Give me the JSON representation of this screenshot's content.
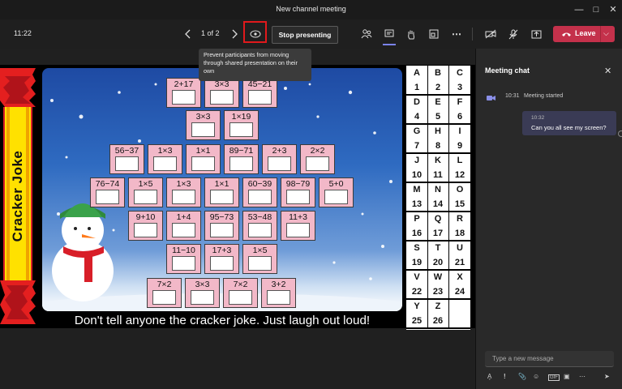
{
  "window": {
    "title": "New channel meeting"
  },
  "toolbar": {
    "time": "11:22",
    "page_count": "1 of 2",
    "stop_label": "Stop presenting",
    "leave_label": "Leave"
  },
  "tooltip": {
    "text": "Prevent participants from moving through shared presentation on their own"
  },
  "slide": {
    "cracker_title": "Cracker Joke",
    "caption": "Don't tell anyone the cracker joke. Just laugh out loud!",
    "rows": [
      [
        "2+17",
        "3×3",
        "45−21"
      ],
      [
        "3×3",
        "1×19"
      ],
      [
        "56−37",
        "1×3",
        "1×1",
        "89−71",
        "2+3",
        "2×2"
      ],
      [
        "76−74",
        "1×5",
        "1×3",
        "1×1",
        "60−39",
        "98−79",
        "5+0"
      ],
      [
        "9+10",
        "1+4",
        "95−73",
        "53−48",
        "11+3"
      ],
      [
        "11−10",
        "17+3",
        "1×5"
      ],
      [
        "7×2",
        "3×3",
        "7×2",
        "3+2"
      ]
    ],
    "key": [
      [
        "A",
        "B",
        "C"
      ],
      [
        "1",
        "2",
        "3"
      ],
      [
        "D",
        "E",
        "F"
      ],
      [
        "4",
        "5",
        "6"
      ],
      [
        "G",
        "H",
        "I"
      ],
      [
        "7",
        "8",
        "9"
      ],
      [
        "J",
        "K",
        "L"
      ],
      [
        "10",
        "11",
        "12"
      ],
      [
        "M",
        "N",
        "O"
      ],
      [
        "13",
        "14",
        "15"
      ],
      [
        "P",
        "Q",
        "R"
      ],
      [
        "16",
        "17",
        "18"
      ],
      [
        "S",
        "T",
        "U"
      ],
      [
        "19",
        "20",
        "21"
      ],
      [
        "V",
        "W",
        "X"
      ],
      [
        "22",
        "23",
        "24"
      ],
      [
        "Y",
        "Z",
        ""
      ],
      [
        "25",
        "26",
        ""
      ]
    ]
  },
  "chat": {
    "title": "Meeting chat",
    "system_time": "10:31",
    "system_text": "Meeting started",
    "message_time": "10:32",
    "message_text": "Can you all see my screen?",
    "compose_placeholder": "Type a new message"
  },
  "colors": {
    "leave": "#c4314b",
    "highlight_box": "#e0191c",
    "tile_pink": "#f2b8c8",
    "chat_bubble": "#3a3b55"
  }
}
